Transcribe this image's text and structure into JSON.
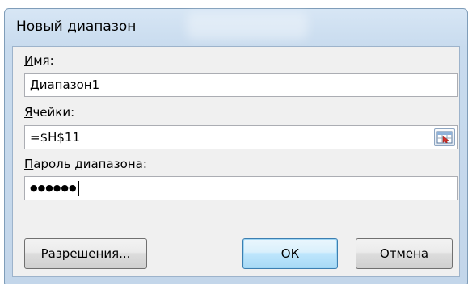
{
  "dialog": {
    "title": "Новый диапазон"
  },
  "fields": {
    "name": {
      "label_access_key": "И",
      "label_rest": "мя:",
      "value": "Диапазон1"
    },
    "cells": {
      "label_access_key": "Я",
      "label_rest": "чейки:",
      "value": "=$H$11"
    },
    "password": {
      "label_access_key": "П",
      "label_rest": "ароль диапазона:",
      "value": "●●●●●●"
    }
  },
  "buttons": {
    "permissions_pre": "Раз",
    "permissions_key": "р",
    "permissions_post": "ешения...",
    "ok": "ОК",
    "cancel": "Отмена"
  },
  "icons": {
    "cell_picker": "collapse-dialog-icon"
  },
  "colors": {
    "frame": "#c8dbee",
    "default_button": "#bee6fd"
  }
}
